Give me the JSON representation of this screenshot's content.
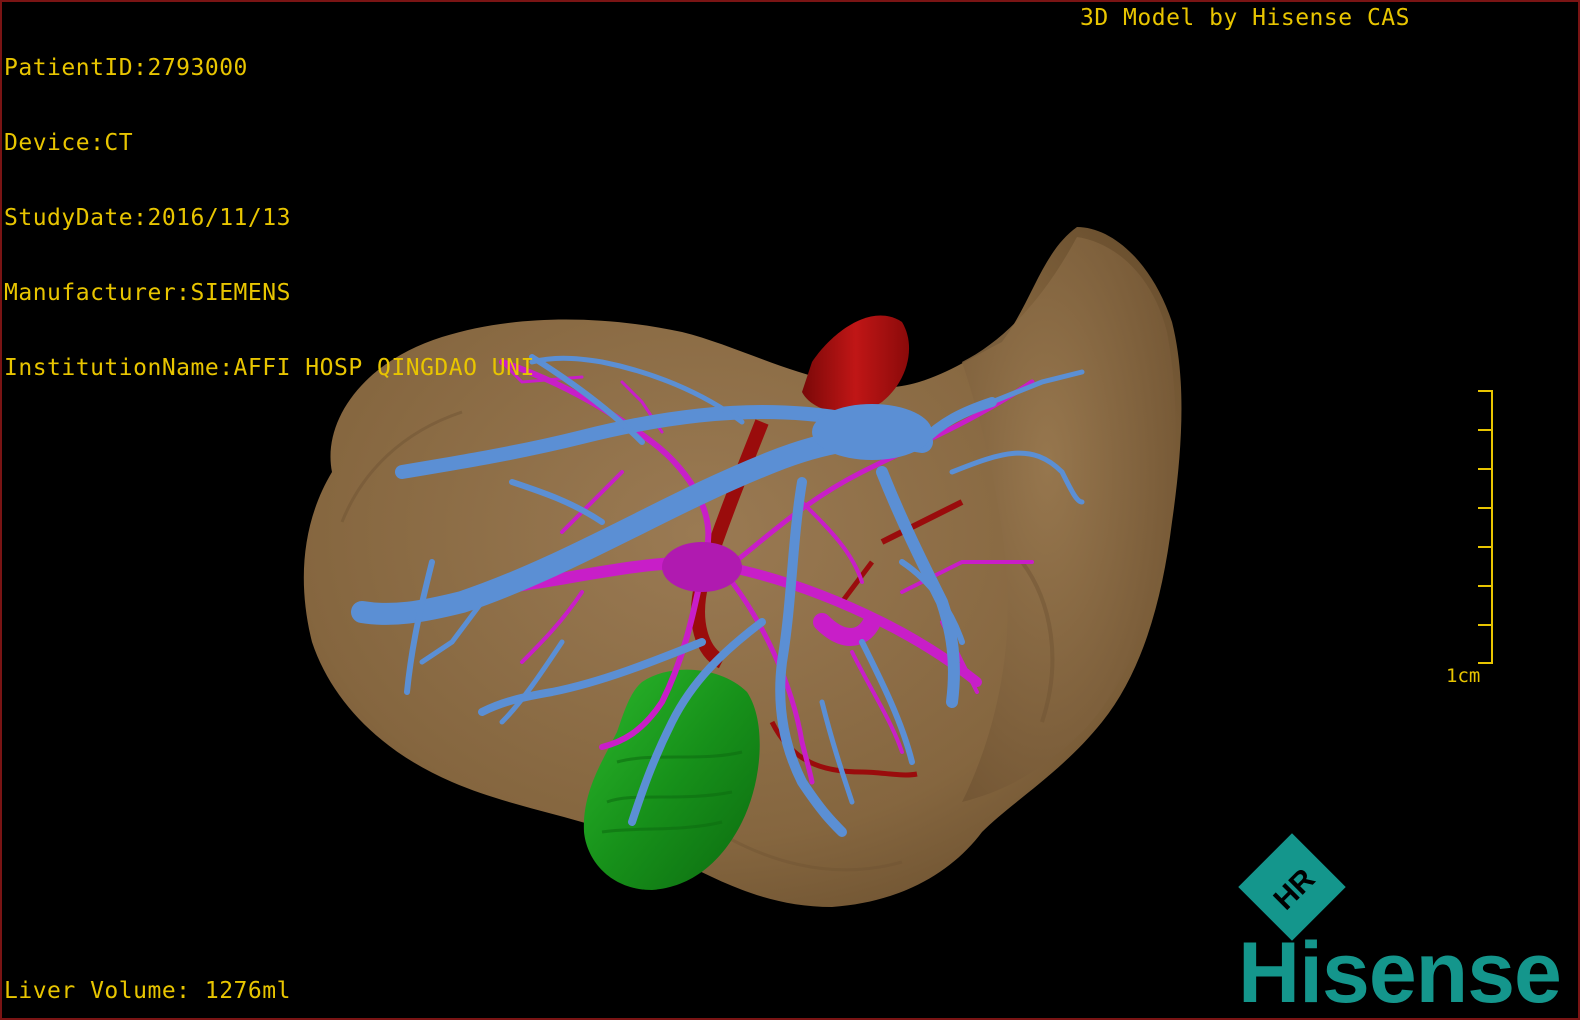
{
  "viewer": {
    "patient_id": "PatientID:2793000",
    "device": "Device:CT",
    "study_date": "StudyDate:2016/11/13",
    "manufacturer": "Manufacturer:SIEMENS",
    "institution": "InstitutionName:AFFI HOSP QINGDAO UNI",
    "credit": "3D Model by Hisense CAS",
    "liver_volume": "Liver Volume: 1276ml",
    "scale_label": "1cm"
  },
  "brand": {
    "logo_text": "HR",
    "name": "Hisense"
  },
  "colors": {
    "overlay_text": "#e8c500",
    "liver": "#8b6b47",
    "portal_vein": "#5b8fd4",
    "hepatic_vessels": "#c81ec8",
    "artery": "#a80e0e",
    "gallbladder": "#1a9a1a",
    "brand": "#14968c"
  }
}
